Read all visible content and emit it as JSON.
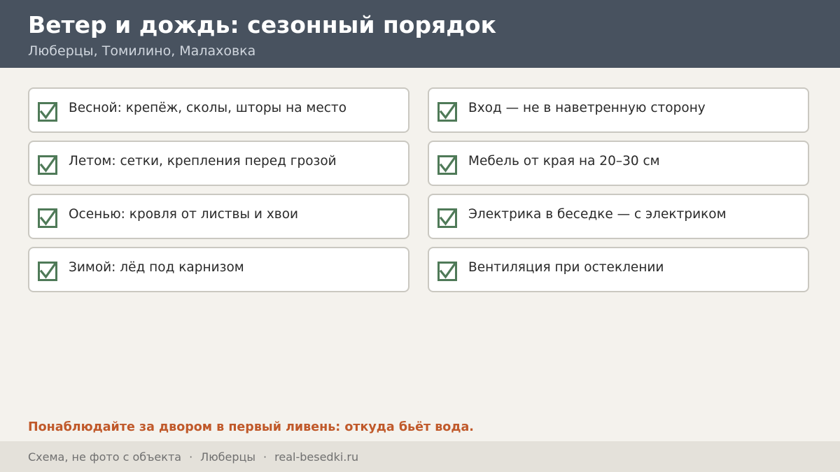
{
  "header": {
    "title": "Ветер и дождь: сезонный порядок",
    "subtitle": "Люберцы, Томилино, Малаховка"
  },
  "checklist": {
    "left": [
      "Весной: крепёж, сколы, шторы на место",
      "Летом: сетки, крепления перед грозой",
      "Осенью: кровля от листвы и хвои",
      "Зимой: лёд под карнизом"
    ],
    "right": [
      "Вход — не в наветренную сторону",
      "Мебель от края на 20–30 см",
      "Электрика в беседке — с электриком",
      "Вентиляция при остеклении"
    ],
    "icon": "checked-box-icon"
  },
  "note": "Понаблюдайте за двором в первый ливень: откуда бьёт вода.",
  "footer": {
    "parts": [
      "Схема, не фото с объекта",
      "Люберцы",
      "real-besedki.ru"
    ],
    "separator": "·"
  },
  "colors": {
    "header_bg": "#48525f",
    "check": "#4f7a58",
    "accent": "#c0592a",
    "page_bg": "#f4f2ed"
  }
}
